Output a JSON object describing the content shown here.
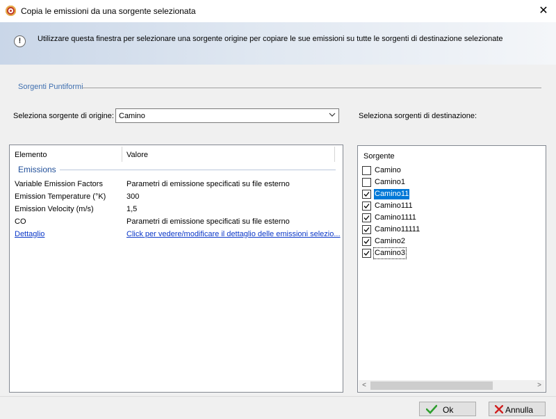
{
  "window": {
    "title": "Copia le emissioni da una sorgente selezionata",
    "close_glyph": "✕"
  },
  "info": {
    "icon": "info-icon",
    "text": "Utilizzare questa finestra per selezionare una sorgente origine per copiare le sue emissioni su tutte le sorgenti di destinazione selezionate"
  },
  "group": {
    "title": "Sorgenti Puntiformi"
  },
  "source": {
    "label": "Seleziona sorgente di origine:",
    "selected": "Camino"
  },
  "destination": {
    "label": "Seleziona sorgenti di destinazione:",
    "header": "Sorgente",
    "items": [
      {
        "name": "Camino",
        "checked": false
      },
      {
        "name": "Camino1",
        "checked": false
      },
      {
        "name": "Camino11",
        "checked": true,
        "selected": true
      },
      {
        "name": "Camino111",
        "checked": true
      },
      {
        "name": "Camino1111",
        "checked": true
      },
      {
        "name": "Camino11111",
        "checked": true
      },
      {
        "name": "Camino2",
        "checked": true
      },
      {
        "name": "Camino3",
        "checked": true,
        "focused": true
      }
    ]
  },
  "properties": {
    "col_element": "Elemento",
    "col_value": "Valore",
    "section": "Emissions",
    "rows": [
      {
        "name": "Variable Emission Factors",
        "value": "Parametri di emissione specificati su file esterno"
      },
      {
        "name": "Emission Temperature (°K)",
        "value": "300"
      },
      {
        "name": "Emission Velocity (m/s)",
        "value": "1,5"
      },
      {
        "name": "CO",
        "value": "Parametri di emissione specificati su file esterno"
      },
      {
        "name": "Dettaglio",
        "value": "Click per vedere/modificare il dettaglio delle emissioni selezio...",
        "link": true
      }
    ]
  },
  "buttons": {
    "ok": "Ok",
    "cancel": "Annulla"
  }
}
